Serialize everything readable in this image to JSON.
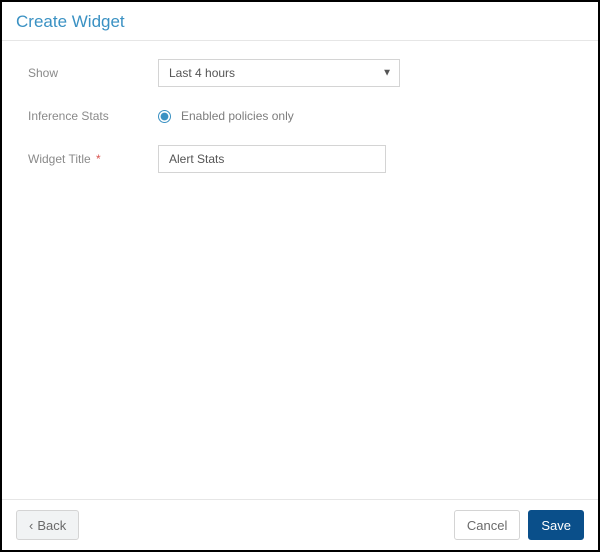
{
  "header": {
    "title": "Create Widget"
  },
  "form": {
    "show": {
      "label": "Show",
      "selected": "Last 4 hours"
    },
    "inference_stats": {
      "label": "Inference Stats",
      "option_label": "Enabled policies only",
      "checked": true
    },
    "widget_title": {
      "label": "Widget Title",
      "required_mark": "*",
      "value": "Alert Stats"
    }
  },
  "footer": {
    "back": "Back",
    "cancel": "Cancel",
    "save": "Save"
  }
}
